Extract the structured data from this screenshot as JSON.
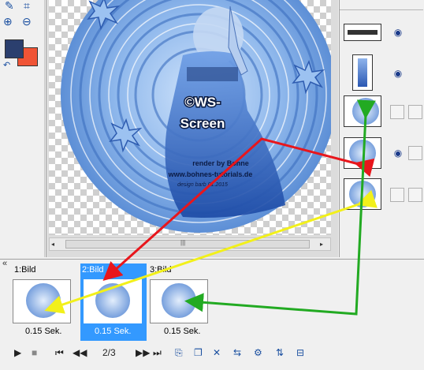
{
  "canvas": {
    "watermark_line1": "©WS-",
    "watermark_line2": "Screen",
    "credit_line1": "render by Bohne",
    "credit_line2": "www.bohnes-tutorials.de",
    "credit_line3": "design barb 01.2015"
  },
  "scrollbar": {
    "grip": "|||"
  },
  "colors": {
    "foreground": "#2b3f6e",
    "background": "#f05436",
    "accent": "#3399ff",
    "arrow_red": "#e8161c",
    "arrow_yellow": "#f2f01a",
    "arrow_green": "#22aa22"
  },
  "frames": [
    {
      "label": "1:Bild",
      "time": "0.15 Sek."
    },
    {
      "label": "2:Bild",
      "time": "0.15 Sek."
    },
    {
      "label": "3:Bild",
      "time": "0.15 Sek."
    }
  ],
  "playback": {
    "counter": "2/3"
  },
  "panel": {
    "collapse": "«"
  }
}
